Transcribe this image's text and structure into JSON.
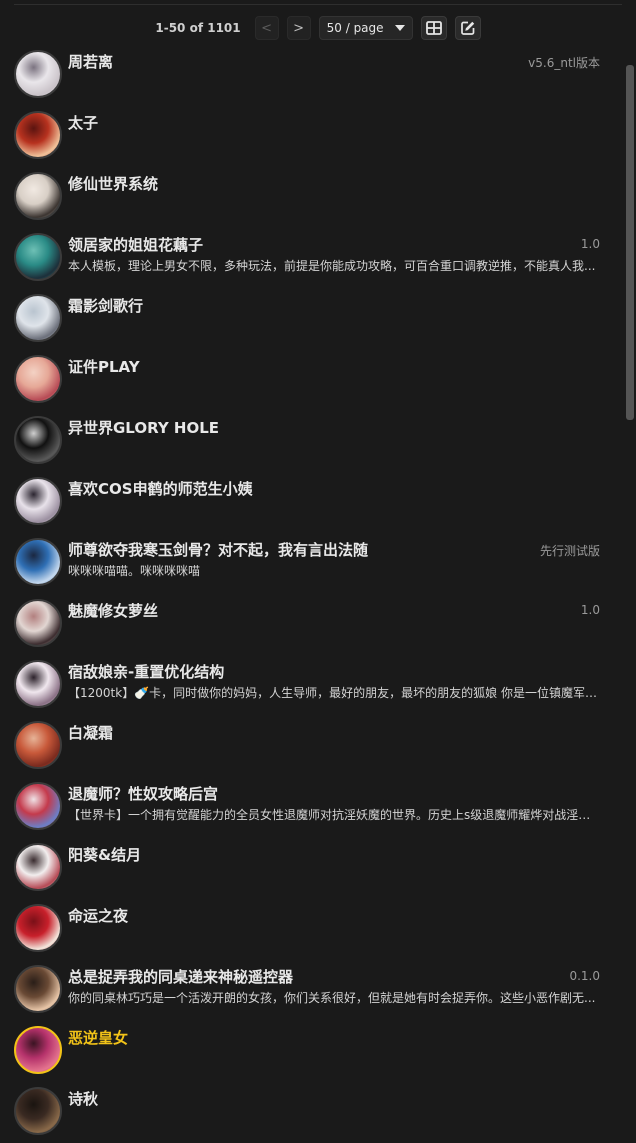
{
  "pagination": {
    "range": "1-50 of 1101",
    "prev": "<",
    "next": ">",
    "page_size": "50 / page"
  },
  "characters": [
    {
      "name": "周若离",
      "version": "v5.6_ntl版本",
      "desc": "",
      "colors": [
        "#e9e6ea",
        "#c9c2c8",
        "#7b7380"
      ]
    },
    {
      "name": "太子",
      "version": "",
      "desc": "",
      "colors": [
        "#b7321f",
        "#f0c29a",
        "#5b1410"
      ]
    },
    {
      "name": "修仙世界系统",
      "version": "",
      "desc": "",
      "colors": [
        "#d8cfc6",
        "#3b3430",
        "#f1e9e2"
      ]
    },
    {
      "name": "领居家的姐姐花藕子",
      "version": "1.0",
      "desc": "本人模板，理论上男女不限，多种玩法，前提是你能成功攻略，可百合重口调教逆推，不能真人我...",
      "colors": [
        "#2a8b86",
        "#1d2f3a",
        "#6ec0b5"
      ]
    },
    {
      "name": "霜影剑歌行",
      "version": "",
      "desc": "",
      "colors": [
        "#dfe4ea",
        "#6b6f7a",
        "#b9c4cf"
      ]
    },
    {
      "name": "证件PLAY",
      "version": "",
      "desc": "",
      "colors": [
        "#e6a897",
        "#b74a55",
        "#f3d2c4"
      ]
    },
    {
      "name": "异世界GLORY HOLE",
      "version": "",
      "desc": "",
      "colors": [
        "#111111",
        "#5a5a5a",
        "#cfcfcf"
      ]
    },
    {
      "name": "喜欢COS申鹤的师范生小姨",
      "version": "",
      "desc": "",
      "colors": [
        "#e8e2ea",
        "#9b8fa0",
        "#2b2530"
      ]
    },
    {
      "name": "师尊欲夺我寒玉剑骨？对不起，我有言出法随",
      "version": "先行测试版",
      "desc": "咪咪咪喵喵。咪咪咪咪喵",
      "colors": [
        "#2f6fb5",
        "#c6d9ee",
        "#1b2740"
      ]
    },
    {
      "name": "魅魔修女萝丝",
      "version": "1.0",
      "desc": "",
      "colors": [
        "#e2d6d2",
        "#3b2b2e",
        "#b2807f"
      ]
    },
    {
      "name": "宿敌娘亲-重置优化结构",
      "version": "",
      "desc": "【1200tk】🍼卡，同时做你的妈妈，人生导师，最好的朋友，最坏的朋友的狐娘 你是一位镇魔军将...",
      "colors": [
        "#f0e7ee",
        "#8a7085",
        "#2c222b"
      ]
    },
    {
      "name": "白凝霜",
      "version": "",
      "desc": "",
      "colors": [
        "#c8593a",
        "#7a2a1e",
        "#e6b397"
      ]
    },
    {
      "name": "退魔师？性奴攻略后宫",
      "version": "",
      "desc": "【世界卡】一个拥有觉醒能力的全员女性退魔师对抗淫妖魔的世界。历史上s级退魔师耀烨对战淫妖...",
      "colors": [
        "#c43a4c",
        "#6b7fc7",
        "#efe2e6"
      ]
    },
    {
      "name": "阳葵&结月",
      "version": "",
      "desc": "",
      "colors": [
        "#f2eeee",
        "#b64a55",
        "#3a2c2f"
      ]
    },
    {
      "name": "命运之夜",
      "version": "",
      "desc": "",
      "colors": [
        "#c8202b",
        "#f3e7dd",
        "#7a1018"
      ]
    },
    {
      "name": "总是捉弄我的同桌递来神秘遥控器",
      "version": "0.1.0",
      "desc": "你的同桌林巧巧是一个活泼开朗的女孩，你们关系很好，但就是她有时会捉弄你。这些小恶作剧无...",
      "colors": [
        "#6a4a35",
        "#e8c6a8",
        "#2a1e18"
      ]
    },
    {
      "name": "恶逆皇女",
      "version": "",
      "desc": "",
      "colors": [
        "#b5326b",
        "#e5758f",
        "#3a1422"
      ],
      "selected": true
    },
    {
      "name": "诗秋",
      "version": "",
      "desc": "",
      "colors": [
        "#3a2a22",
        "#8a6a4a",
        "#1a1410"
      ]
    }
  ],
  "icons": {
    "grid": "grid-icon",
    "edit": "edit-icon"
  },
  "accent_color": "#f2c318"
}
